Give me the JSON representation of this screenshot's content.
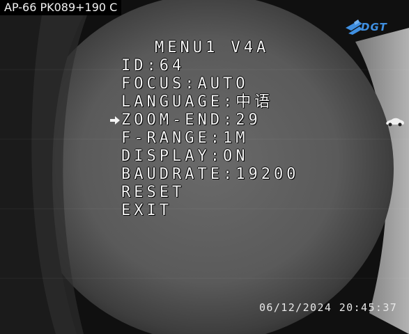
{
  "camera": {
    "title": "AP-66 PK089+190 C",
    "logo_text": "DGT",
    "timestamp": "06/12/2024 20:45:37"
  },
  "menu": {
    "title": "MENU1 V4A",
    "selected_index": 3,
    "items": [
      {
        "label": "ID:64"
      },
      {
        "label": "FOCUS:AUTO"
      },
      {
        "label": "LANGUAGE:中语"
      },
      {
        "label": "ZOOM-END:29"
      },
      {
        "label": "F-RANGE:1M"
      },
      {
        "label": "DISPLAY:ON"
      },
      {
        "label": "BAUDRATE:19200"
      },
      {
        "label": "RESET"
      },
      {
        "label": "EXIT"
      }
    ]
  },
  "icons": {
    "cursor": "arrow-right-icon",
    "logo": "dgt-logo-icon",
    "vehicle": "car-icon"
  },
  "colors": {
    "osd_text": "#f4f4f4",
    "logo_blue": "#3f8fe0",
    "title_bar_bg": "#000000"
  }
}
